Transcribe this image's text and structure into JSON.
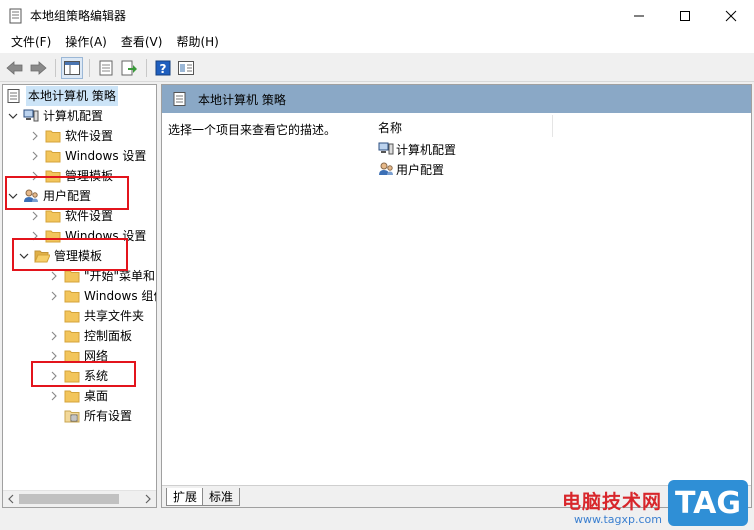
{
  "window": {
    "title": "本地组策略编辑器"
  },
  "menu": [
    "文件(F)",
    "操作(A)",
    "查看(V)",
    "帮助(H)"
  ],
  "toolbar": {
    "icons": [
      "back-arrow-icon",
      "forward-arrow-icon",
      "show-tree-icon",
      "properties-icon",
      "export-icon",
      "help-icon",
      "filter-view-icon"
    ]
  },
  "tree": {
    "root": "本地计算机 策略",
    "computer_config": "计算机配置",
    "computer_children": [
      "软件设置",
      "Windows 设置",
      "管理模板"
    ],
    "user_config": "用户配置",
    "user_children": [
      "软件设置",
      "Windows 设置"
    ],
    "admin_templates": "管理模板",
    "admin_children": [
      "\"开始\"菜单和",
      "Windows 组件",
      "共享文件夹",
      "控制面板",
      "网络",
      "系统",
      "桌面",
      "所有设置"
    ]
  },
  "right_pane": {
    "header": "本地计算机 策略",
    "description": "选择一个项目来查看它的描述。",
    "column_name": "名称",
    "items": [
      "计算机配置",
      "用户配置"
    ]
  },
  "tabs": [
    "扩展",
    "标准"
  ],
  "watermark": {
    "title": "电脑技术网",
    "url": "www.tagxp.com",
    "badge": "TAG"
  },
  "colors": {
    "header_bar": "#8aa8c6",
    "callout": "#e3141c",
    "folder": "#f2c55c",
    "selection": "#cce4f7"
  }
}
